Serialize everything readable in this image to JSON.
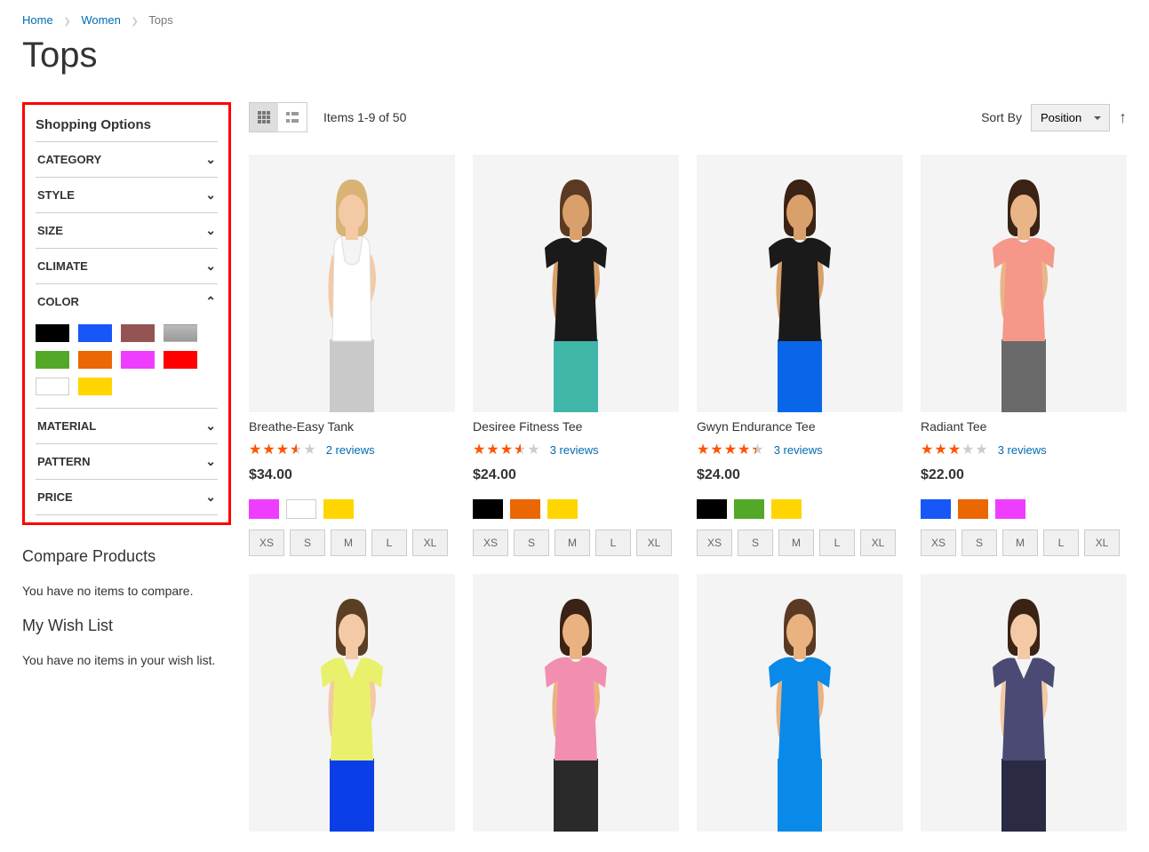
{
  "breadcrumb": {
    "home": "Home",
    "women": "Women",
    "current": "Tops"
  },
  "page_title": "Tops",
  "sidebar": {
    "filter_title": "Shopping Options",
    "filters": {
      "category": "CATEGORY",
      "style": "STYLE",
      "size": "SIZE",
      "climate": "CLIMATE",
      "color": "COLOR",
      "material": "MATERIAL",
      "pattern": "PATTERN",
      "price": "PRICE"
    },
    "colors": [
      {
        "name": "black",
        "hex": "#000000"
      },
      {
        "name": "blue",
        "hex": "#1857f7"
      },
      {
        "name": "brown",
        "hex": "#945454"
      },
      {
        "name": "gray",
        "hex": "gray"
      },
      {
        "name": "green",
        "hex": "#53a828"
      },
      {
        "name": "orange",
        "hex": "#eb6703"
      },
      {
        "name": "magenta",
        "hex": "#ef3dff"
      },
      {
        "name": "red",
        "hex": "#ff0000"
      },
      {
        "name": "white",
        "hex": "#ffffff"
      },
      {
        "name": "yellow",
        "hex": "#ffd500"
      }
    ],
    "compare_title": "Compare Products",
    "compare_empty": "You have no items to compare.",
    "wishlist_title": "My Wish List",
    "wishlist_empty": "You have no items in your wish list."
  },
  "toolbar": {
    "count_text": "Items 1-9 of 50",
    "sort_label": "Sort By",
    "sort_value": "Position"
  },
  "sizes": [
    "XS",
    "S",
    "M",
    "L",
    "XL"
  ],
  "products": [
    {
      "name": "Breathe-Easy Tank",
      "rating_pct": 70,
      "reviews": "2 reviews",
      "price": "$34.00",
      "colors": [
        {
          "n": "purple",
          "h": "#ef3dff"
        },
        {
          "n": "white",
          "h": "#ffffff"
        },
        {
          "n": "yellow",
          "h": "#ffd500"
        }
      ],
      "fig": {
        "skin": "#f3c9a6",
        "hair": "#d8b374",
        "top": "#ffffff",
        "bottom": "#c9c9c9",
        "type": "tank"
      }
    },
    {
      "name": "Desiree Fitness Tee",
      "rating_pct": 70,
      "reviews": "3 reviews",
      "price": "$24.00",
      "colors": [
        {
          "n": "black",
          "h": "#000000"
        },
        {
          "n": "orange",
          "h": "#eb6703"
        },
        {
          "n": "yellow",
          "h": "#ffd500"
        }
      ],
      "fig": {
        "skin": "#d9a06b",
        "hair": "#5a3a23",
        "top": "#1a1a1a",
        "bottom": "#3fb6a8",
        "type": "tee"
      }
    },
    {
      "name": "Gwyn Endurance Tee",
      "rating_pct": 87,
      "reviews": "3 reviews",
      "price": "$24.00",
      "colors": [
        {
          "n": "black",
          "h": "#000000"
        },
        {
          "n": "green",
          "h": "#53a828"
        },
        {
          "n": "yellow",
          "h": "#ffd500"
        }
      ],
      "fig": {
        "skin": "#d9a06b",
        "hair": "#3a2214",
        "top": "#1a1a1a",
        "bottom": "#0a66e8",
        "type": "tee"
      }
    },
    {
      "name": "Radiant Tee",
      "rating_pct": 60,
      "reviews": "3 reviews",
      "price": "$22.00",
      "colors": [
        {
          "n": "blue",
          "h": "#1857f7"
        },
        {
          "n": "orange",
          "h": "#eb6703"
        },
        {
          "n": "purple",
          "h": "#ef3dff"
        }
      ],
      "fig": {
        "skin": "#e9b587",
        "hair": "#3a2214",
        "top": "#f59789",
        "bottom": "#6a6a6a",
        "type": "tee"
      }
    },
    {
      "name": "",
      "rating_pct": 0,
      "reviews": "",
      "price": "",
      "colors": [],
      "partial": true,
      "fig": {
        "skin": "#f3c9a6",
        "hair": "#5a3f24",
        "top": "#e9f06b",
        "bottom": "#0a3fe8",
        "type": "vee"
      }
    },
    {
      "name": "",
      "rating_pct": 0,
      "reviews": "",
      "price": "",
      "colors": [],
      "partial": true,
      "fig": {
        "skin": "#eab280",
        "hair": "#3a2214",
        "top": "#f28fb1",
        "bottom": "#2a2a2a",
        "type": "tee"
      }
    },
    {
      "name": "",
      "rating_pct": 0,
      "reviews": "",
      "price": "",
      "colors": [],
      "partial": true,
      "fig": {
        "skin": "#eab280",
        "hair": "#5a3a23",
        "top": "#0a8ae8",
        "bottom": "#0a8ae8",
        "type": "tee"
      }
    },
    {
      "name": "",
      "rating_pct": 0,
      "reviews": "",
      "price": "",
      "colors": [],
      "partial": true,
      "fig": {
        "skin": "#f3c9a6",
        "hair": "#3a2214",
        "top": "#4a4a74",
        "bottom": "#2a2a44",
        "type": "vee"
      }
    }
  ]
}
